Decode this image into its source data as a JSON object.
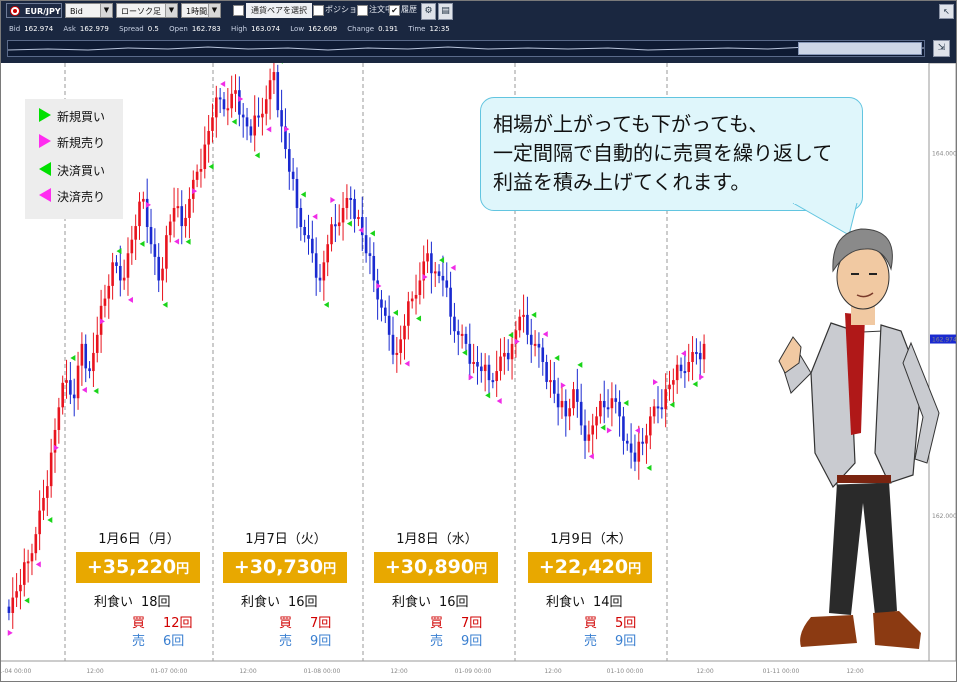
{
  "toolbar": {
    "pair": "EUR/JPY",
    "price_type": "Bid",
    "chart_type": "ローソク足",
    "period": "1時間足",
    "select_pair_label": "通貨ペアを選択",
    "position_label": "ポジション",
    "order_label": "注文中",
    "history_label": "履歴",
    "history_checked": "✔"
  },
  "quote": {
    "bid_label": "Bid",
    "bid": "162.974",
    "ask_label": "Ask",
    "ask": "162.979",
    "spread_label": "Spread",
    "spread": "0.5",
    "open_label": "Open",
    "open": "162.783",
    "high_label": "High",
    "high": "163.074",
    "low_label": "Low",
    "low": "162.609",
    "change_label": "Change",
    "change": "0.191",
    "time_label": "Time",
    "time": "12:35"
  },
  "price_axis": {
    "labels": [
      "164.000",
      "162.974",
      "162.000"
    ],
    "current": "162.974"
  },
  "time_axis": {
    "labels": [
      "01-04 00:00",
      "12:00",
      "01-07 00:00",
      "12:00",
      "01-08 00:00",
      "12:00",
      "01-09 00:00",
      "12:00",
      "01-10 00:00",
      "12:00",
      "01-11 00:00",
      "12:00"
    ]
  },
  "legend": {
    "items": [
      {
        "label": "新規買い",
        "icon": "green-right-triangle"
      },
      {
        "label": "新規売り",
        "icon": "magenta-right-triangle"
      },
      {
        "label": "決済買い",
        "icon": "green-left-triangle"
      },
      {
        "label": "決済売り",
        "icon": "magenta-left-triangle"
      }
    ]
  },
  "bubble": {
    "lines": [
      "相場が上がっても下がっても、",
      "一定間隔で自動的に売買を繰り返して",
      "利益を積み上げてくれます。"
    ]
  },
  "days": [
    {
      "date": "1月6日（月）",
      "profit": "+35,220",
      "unit": "円",
      "count_label": "利食い",
      "count": "18回",
      "buy_label": "買",
      "buy": "12回",
      "sell_label": "売",
      "sell": "6回"
    },
    {
      "date": "1月7日（火）",
      "profit": "+30,730",
      "unit": "円",
      "count_label": "利食い",
      "count": "16回",
      "buy_label": "買",
      "buy": "7回",
      "sell_label": "売",
      "sell": "9回"
    },
    {
      "date": "1月8日（水）",
      "profit": "+30,890",
      "unit": "円",
      "count_label": "利食い",
      "count": "16回",
      "buy_label": "買",
      "buy": "7回",
      "sell_label": "売",
      "sell": "9回"
    },
    {
      "date": "1月9日（木）",
      "profit": "+22,420",
      "unit": "円",
      "count_label": "利食い",
      "count": "14回",
      "buy_label": "買",
      "buy": "5回",
      "sell_label": "売",
      "sell": "9回"
    }
  ],
  "colors": {
    "up_candle": "#e8141e",
    "down_candle": "#1a2ad0",
    "profit_box": "#e8a800",
    "buy_text": "#d00000",
    "sell_text": "#3a7fd0",
    "bubble_bg": "#dff6fb",
    "toolbar_bg": "#1a2740"
  },
  "chart_data": {
    "type": "candlestick",
    "instrument": "EUR/JPY",
    "timeframe": "1時間足",
    "ylim": [
      161.2,
      164.5
    ],
    "tick_labels_y": [
      164.0,
      162.974,
      162.0
    ],
    "day_separators": [
      "01-04 00:00",
      "01-07 00:00",
      "01-08 00:00",
      "01-09 00:00",
      "01-10 00:00"
    ],
    "close_path": [
      161.55,
      161.62,
      161.75,
      161.9,
      162.1,
      162.35,
      162.6,
      162.75,
      162.65,
      162.95,
      162.8,
      163.0,
      163.2,
      163.4,
      163.3,
      163.45,
      163.6,
      163.75,
      163.5,
      163.3,
      163.55,
      163.7,
      163.6,
      163.75,
      163.9,
      164.05,
      164.2,
      164.3,
      164.25,
      164.35,
      164.2,
      164.1,
      164.2,
      164.3,
      164.45,
      164.15,
      163.9,
      163.7,
      163.55,
      163.45,
      163.3,
      163.5,
      163.6,
      163.7,
      163.75,
      163.65,
      163.45,
      163.3,
      163.15,
      163.0,
      162.9,
      163.05,
      163.2,
      163.3,
      163.45,
      163.35,
      163.3,
      163.1,
      163.0,
      162.95,
      162.85,
      162.8,
      162.75,
      162.8,
      162.9,
      162.95,
      163.1,
      163.0,
      162.95,
      162.85,
      162.75,
      162.6,
      162.55,
      162.7,
      162.5,
      162.45,
      162.55,
      162.6,
      162.65,
      162.55,
      162.4,
      162.3,
      162.4,
      162.55,
      162.6,
      162.7,
      162.75,
      162.8,
      162.85,
      162.9,
      162.95
    ]
  }
}
